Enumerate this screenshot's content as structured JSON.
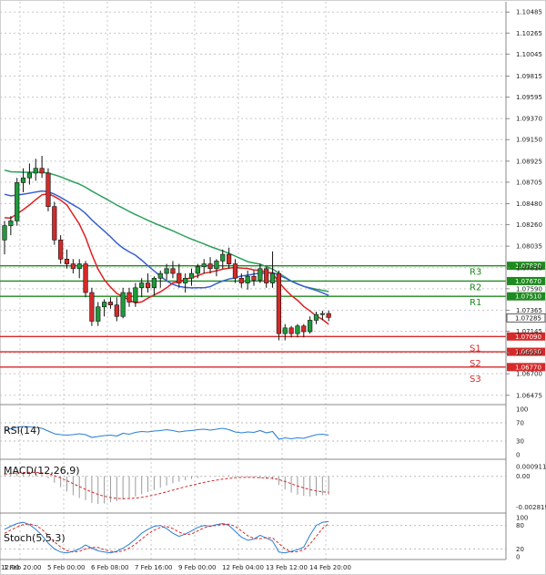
{
  "chart_data": [
    {
      "type": "candlestick",
      "price_ticks": [
        "1.10485",
        "1.10265",
        "1.10045",
        "1.09815",
        "1.09595",
        "1.09370",
        "1.09150",
        "1.08925",
        "1.08705",
        "1.08480",
        "1.08260",
        "1.08035",
        "1.07810",
        "1.07590",
        "1.07365",
        "1.07145",
        "1.06920",
        "1.06700",
        "1.06475"
      ],
      "ylim": [
        1.06425,
        1.10535
      ],
      "x_labels": [
        "12:00",
        "1 Feb 20:00",
        "5 Feb 00:00",
        "6 Feb 08:00",
        "7 Feb 16:00",
        "9 Feb 00:00",
        "12 Feb 04:00",
        "13 Feb 12:00",
        "14 Feb 20:00"
      ],
      "levels": [
        {
          "name": "R3",
          "value": "1.07830",
          "color": "#1f8a1f"
        },
        {
          "name": "R2",
          "value": "1.07670",
          "color": "#1f8a1f"
        },
        {
          "name": "R1",
          "value": "1.07510",
          "color": "#1f8a1f"
        },
        {
          "name": "S1",
          "value": "1.07090",
          "color": "#d42a2a"
        },
        {
          "name": "S2",
          "value": "1.06930",
          "color": "#d42a2a"
        },
        {
          "name": "S3",
          "value": "1.06770",
          "color": "#d42a2a"
        }
      ],
      "current_price": "1.07285",
      "candles": [
        [
          1.081,
          1.083,
          1.0795,
          1.0825
        ],
        [
          1.0825,
          1.0835,
          1.0815,
          1.083
        ],
        [
          1.083,
          1.0875,
          1.0825,
          1.087
        ],
        [
          1.087,
          1.0885,
          1.086,
          1.0875
        ],
        [
          1.0875,
          1.089,
          1.0868,
          1.088
        ],
        [
          1.088,
          1.0895,
          1.0872,
          1.0885
        ],
        [
          1.0885,
          1.0898,
          1.0875,
          1.088
        ],
        [
          1.088,
          1.0885,
          1.084,
          1.0845
        ],
        [
          1.0845,
          1.085,
          1.0805,
          1.081
        ],
        [
          1.081,
          1.0815,
          1.0785,
          1.079
        ],
        [
          1.079,
          1.08,
          1.078,
          1.0785
        ],
        [
          1.0785,
          1.079,
          1.0775,
          1.078
        ],
        [
          1.078,
          1.079,
          1.077,
          1.0785
        ],
        [
          1.0785,
          1.0788,
          1.075,
          1.0755
        ],
        [
          1.0755,
          1.076,
          1.072,
          1.0725
        ],
        [
          1.0725,
          1.0745,
          1.072,
          1.074
        ],
        [
          1.074,
          1.0748,
          1.073,
          1.0745
        ],
        [
          1.0745,
          1.075,
          1.0738,
          1.0742
        ],
        [
          1.0742,
          1.075,
          1.0725,
          1.073
        ],
        [
          1.073,
          1.076,
          1.0728,
          1.0755
        ],
        [
          1.0755,
          1.076,
          1.074,
          1.0745
        ],
        [
          1.0745,
          1.0765,
          1.074,
          1.076
        ],
        [
          1.076,
          1.077,
          1.075,
          1.0765
        ],
        [
          1.0765,
          1.0775,
          1.0755,
          1.076
        ],
        [
          1.076,
          1.0772,
          1.0752,
          1.077
        ],
        [
          1.077,
          1.0778,
          1.076,
          1.0775
        ],
        [
          1.0775,
          1.0785,
          1.0768,
          1.078
        ],
        [
          1.078,
          1.0788,
          1.077,
          1.0775
        ],
        [
          1.0775,
          1.0785,
          1.076,
          1.0765
        ],
        [
          1.0765,
          1.0775,
          1.0755,
          1.077
        ],
        [
          1.077,
          1.078,
          1.0762,
          1.0775
        ],
        [
          1.0775,
          1.0785,
          1.077,
          1.0782
        ],
        [
          1.0782,
          1.079,
          1.0775,
          1.0785
        ],
        [
          1.0785,
          1.0792,
          1.0775,
          1.078
        ],
        [
          1.078,
          1.079,
          1.0772,
          1.0788
        ],
        [
          1.0788,
          1.08,
          1.078,
          1.0795
        ],
        [
          1.0795,
          1.0802,
          1.078,
          1.0785
        ],
        [
          1.0785,
          1.079,
          1.0765,
          1.077
        ],
        [
          1.077,
          1.0775,
          1.076,
          1.0765
        ],
        [
          1.0765,
          1.0778,
          1.0758,
          1.0772
        ],
        [
          1.0772,
          1.0778,
          1.0762,
          1.0768
        ],
        [
          1.0768,
          1.0785,
          1.0765,
          1.078
        ],
        [
          1.078,
          1.0782,
          1.076,
          1.0765
        ],
        [
          1.0765,
          1.0798,
          1.076,
          1.0775
        ],
        [
          1.0775,
          1.0778,
          1.0705,
          1.0712
        ],
        [
          1.0712,
          1.0722,
          1.0705,
          1.0718
        ],
        [
          1.0718,
          1.072,
          1.0708,
          1.0712
        ],
        [
          1.0712,
          1.0722,
          1.0708,
          1.072
        ],
        [
          1.072,
          1.0722,
          1.0708,
          1.0714
        ],
        [
          1.0714,
          1.073,
          1.0712,
          1.0726
        ],
        [
          1.0726,
          1.0735,
          1.0722,
          1.0732
        ],
        [
          1.0732,
          1.0736,
          1.0726,
          1.0733
        ],
        [
          1.0733,
          1.0736,
          1.0725,
          1.0729
        ]
      ],
      "sma_fast_color": "#e02020",
      "sma_mid_color": "#3a5fd0",
      "sma_slow_color": "#2aa05a",
      "grid": true
    },
    {
      "type": "line",
      "title": "RSI(14)",
      "ticks": [
        "100",
        "70",
        "30",
        "0"
      ],
      "ylim": [
        0,
        100
      ],
      "color": "#2b7fd4",
      "values": [
        55,
        57,
        60,
        62,
        61,
        60,
        58,
        52,
        46,
        44,
        43,
        44,
        46,
        44,
        38,
        40,
        42,
        43,
        41,
        47,
        45,
        49,
        51,
        50,
        52,
        53,
        55,
        53,
        50,
        52,
        53,
        55,
        56,
        54,
        56,
        58,
        55,
        50,
        48,
        50,
        49,
        53,
        48,
        51,
        34,
        37,
        35,
        37,
        36,
        40,
        44,
        45,
        43
      ]
    },
    {
      "type": "bar",
      "title": "MACD(12,26,9)",
      "ticks": [
        "0.000911",
        "0.00",
        "-0.002819"
      ],
      "ylim": [
        -0.00305,
        0.00115
      ],
      "bar_color": "#9a9a9a",
      "signal_color": "#d42a2a",
      "values": [
        0.0003,
        0.00035,
        0.0004,
        0.00042,
        0.0004,
        0.00035,
        0.0002,
        -0.0002,
        -0.0006,
        -0.001,
        -0.0014,
        -0.00175,
        -0.002,
        -0.0022,
        -0.00245,
        -0.00255,
        -0.0025,
        -0.0024,
        -0.0023,
        -0.00215,
        -0.002,
        -0.00185,
        -0.00165,
        -0.00145,
        -0.00125,
        -0.00105,
        -0.00085,
        -0.00065,
        -0.0005,
        -0.00035,
        -0.00025,
        -0.00015,
        -5e-05,
        0.0,
        5e-05,
        8e-05,
        0.0001,
        8e-05,
        2e-05,
        -5e-05,
        -0.00012,
        -0.00018,
        -0.00025,
        -0.0003,
        -0.0008,
        -0.0012,
        -0.0015,
        -0.0017,
        -0.0018,
        -0.00185,
        -0.0018,
        -0.00175,
        -0.0017
      ],
      "signal": [
        0.0002,
        0.00025,
        0.0003,
        0.00034,
        0.00036,
        0.00036,
        0.00032,
        0.00022,
        6e-05,
        -0.00015,
        -0.0004,
        -0.00067,
        -0.00094,
        -0.0012,
        -0.00145,
        -0.00167,
        -0.00184,
        -0.00196,
        -0.00203,
        -0.00206,
        -0.00205,
        -0.00201,
        -0.00194,
        -0.00184,
        -0.00172,
        -0.00158,
        -0.00143,
        -0.00128,
        -0.00112,
        -0.00097,
        -0.00083,
        -0.00069,
        -0.00056,
        -0.00045,
        -0.00035,
        -0.00026,
        -0.00019,
        -0.00013,
        -0.0001,
        -9e-05,
        -0.0001,
        -0.00012,
        -0.00015,
        -0.00018,
        -0.0003,
        -0.00048,
        -0.00068,
        -0.00089,
        -0.00107,
        -0.00123,
        -0.00135,
        -0.00143,
        -0.00149
      ]
    },
    {
      "type": "line",
      "title": "Stoch(5,5,3)",
      "ticks": [
        "100",
        "80",
        "20",
        "0"
      ],
      "ylim": [
        0,
        100
      ],
      "k_color": "#2b7fd4",
      "d_color": "#d42a2a",
      "k": [
        70,
        78,
        85,
        88,
        82,
        70,
        55,
        35,
        20,
        12,
        10,
        14,
        20,
        30,
        22,
        15,
        12,
        10,
        14,
        22,
        32,
        45,
        60,
        70,
        78,
        80,
        72,
        60,
        52,
        58,
        66,
        75,
        80,
        78,
        82,
        85,
        80,
        65,
        50,
        42,
        45,
        55,
        48,
        40,
        12,
        10,
        14,
        18,
        25,
        55,
        80,
        88,
        90
      ],
      "d": [
        60,
        68,
        76,
        82,
        84,
        80,
        70,
        55,
        38,
        25,
        16,
        12,
        14,
        20,
        24,
        24,
        18,
        14,
        12,
        15,
        22,
        32,
        45,
        58,
        68,
        75,
        77,
        72,
        63,
        57,
        58,
        66,
        74,
        78,
        80,
        82,
        83,
        78,
        66,
        54,
        47,
        46,
        49,
        48,
        34,
        20,
        12,
        13,
        18,
        32,
        52,
        72,
        85
      ]
    }
  ]
}
